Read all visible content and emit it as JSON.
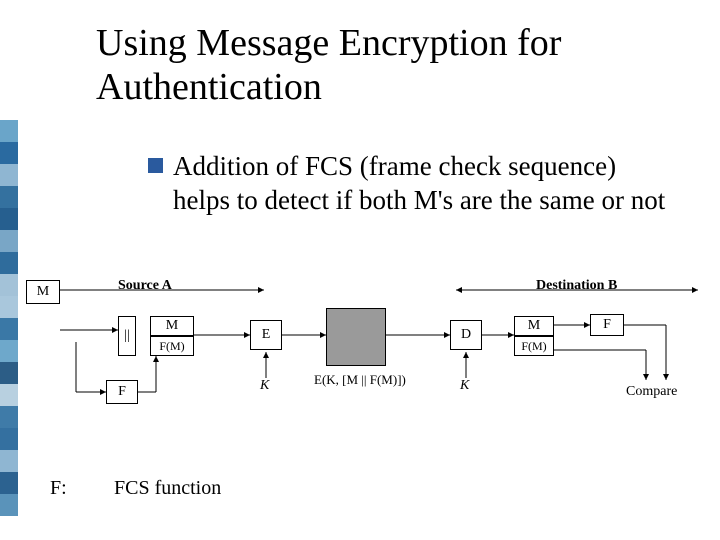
{
  "title": "Using Message Encryption for Authentication",
  "bullet": "Addition of FCS (frame check sequence) helps to detect if both M's are the same or not",
  "legend": {
    "key": "F:",
    "value": "FCS function"
  },
  "diagram": {
    "source_label": "Source A",
    "dest_label": "Destination B",
    "M": "M",
    "F": "F",
    "FM": "F(M)",
    "concat": "||",
    "E": "E",
    "D": "D",
    "K": "K",
    "cipher": "E(K, [M || F(M)])",
    "compare": "Compare"
  },
  "sidebar_colors": [
    "#6aa5c9",
    "#2a6aa0",
    "#8fb6d2",
    "#34719f",
    "#265f8f",
    "#79a6c6",
    "#2f6c9c",
    "#a3c2d8",
    "#a9c7dc",
    "#3a78a6",
    "#6ea8cb",
    "#2c5d86",
    "#b8d0e0",
    "#3f7ba8",
    "#3470a0",
    "#8fb6d2",
    "#2c6290",
    "#5a93ba"
  ]
}
